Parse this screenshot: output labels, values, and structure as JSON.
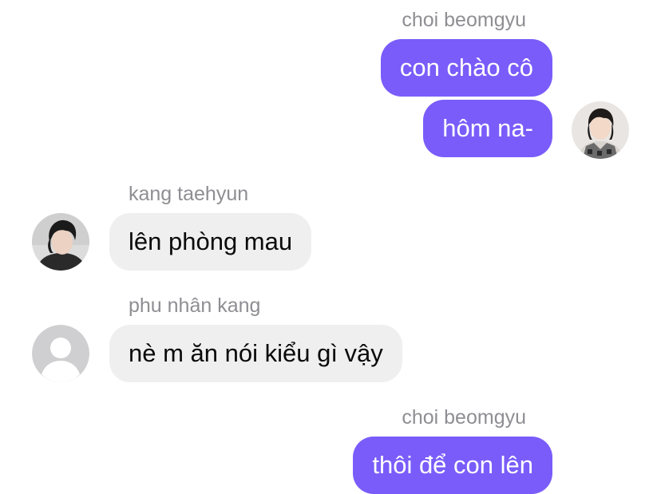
{
  "messages": [
    {
      "sender": "choi beomgyu",
      "text": "con chào cô",
      "direction": "outgoing"
    },
    {
      "sender": "",
      "text": "hôm na-",
      "direction": "outgoing",
      "avatar": "beomgyu-avatar-photo"
    },
    {
      "sender": "kang taehyun",
      "text": "lên phòng mau",
      "direction": "incoming",
      "avatar": "taehyun-avatar-photo"
    },
    {
      "sender": "phu nhân kang",
      "text": "nè m ăn nói kiểu gì vậy",
      "direction": "incoming",
      "avatar": "default-user-icon"
    },
    {
      "sender": "choi beomgyu",
      "text": "thôi để con lên",
      "direction": "outgoing"
    }
  ],
  "colors": {
    "outgoing_bubble": "#7a5cfa",
    "incoming_bubble": "#efefef",
    "sender_name": "#8e8e93"
  }
}
